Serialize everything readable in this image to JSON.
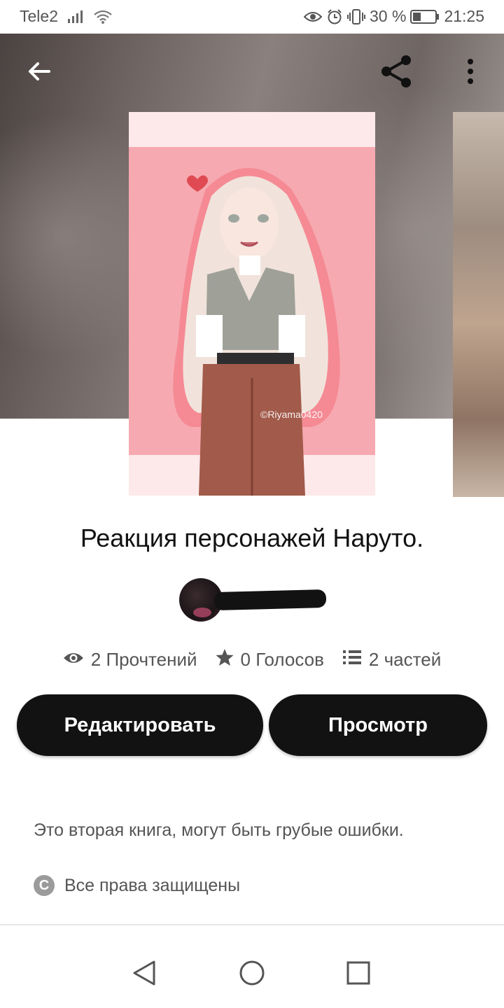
{
  "status_bar": {
    "carrier": "Tele2",
    "battery_percent": "30 %",
    "time": "21:25"
  },
  "toolbar": {
    "back_icon": "arrow-left-icon",
    "share_icon": "share-icon",
    "more_icon": "more-vertical-icon"
  },
  "cover": {
    "watermark": "©Riyama0420"
  },
  "story": {
    "title": "Реакция персонажей Наруто."
  },
  "stats": {
    "reads": "2 Прочтений",
    "votes": "0 Голосов",
    "parts": "2 частей"
  },
  "actions": {
    "edit_label": "Редактировать",
    "view_label": "Просмотр"
  },
  "description": "Это вторая книга, могут быть грубые ошибки.",
  "copyright": {
    "symbol": "C",
    "text": "Все права защищены"
  },
  "colors": {
    "button_bg": "#121212",
    "text_secondary": "#555555",
    "cover_pink": "#f5a9b1"
  }
}
